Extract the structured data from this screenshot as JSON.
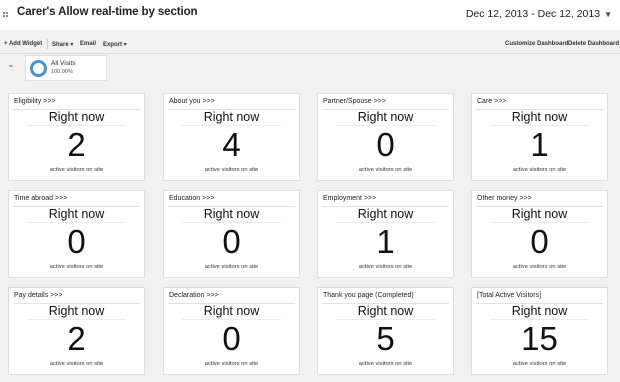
{
  "header": {
    "title": "Carer's Allow real-time by section",
    "date_range": "Dec 12, 2013 - Dec 12, 2013",
    "date_caret": "▼"
  },
  "toolbar": {
    "add_widget": "+ Add Widget",
    "share": "Share ▾",
    "email": "Email",
    "export": "Export ▾",
    "customize": "Customize Dashboard",
    "delete": "Delete Dashboard"
  },
  "segment": {
    "chevron": "⌄",
    "name": "All Visits",
    "percent": "100.00%",
    "ring_color": "#4a90d9"
  },
  "widgets": [
    {
      "title": "Eligibility >>>",
      "subtitle": "Right now",
      "value": "2",
      "label": "active visitors on site"
    },
    {
      "title": "About you >>>",
      "subtitle": "Right now",
      "value": "4",
      "label": "active visitors on site"
    },
    {
      "title": "Partner/Spouse >>>",
      "subtitle": "Right now",
      "value": "0",
      "label": "active visitors on site"
    },
    {
      "title": "Care >>>",
      "subtitle": "Right now",
      "value": "1",
      "label": "active visitors on site"
    },
    {
      "title": "Time abroad >>>",
      "subtitle": "Right now",
      "value": "0",
      "label": "active visitors on site"
    },
    {
      "title": "Education >>>",
      "subtitle": "Right now",
      "value": "0",
      "label": "active visitors on site"
    },
    {
      "title": "Employment >>>",
      "subtitle": "Right now",
      "value": "1",
      "label": "active visitors on site"
    },
    {
      "title": "Other money >>>",
      "subtitle": "Right now",
      "value": "0",
      "label": "active visitors on site"
    },
    {
      "title": "Pay details >>>",
      "subtitle": "Right now",
      "value": "2",
      "label": "active visitors on site"
    },
    {
      "title": "Declaration >>>",
      "subtitle": "Right now",
      "value": "0",
      "label": "active visitors on site"
    },
    {
      "title": "Thank you page (Completed)",
      "subtitle": "Right now",
      "value": "5",
      "label": "active visitors on site"
    },
    {
      "title": "[Total Active Visitors]",
      "subtitle": "Right now",
      "value": "15",
      "label": "active visitors on site"
    }
  ]
}
